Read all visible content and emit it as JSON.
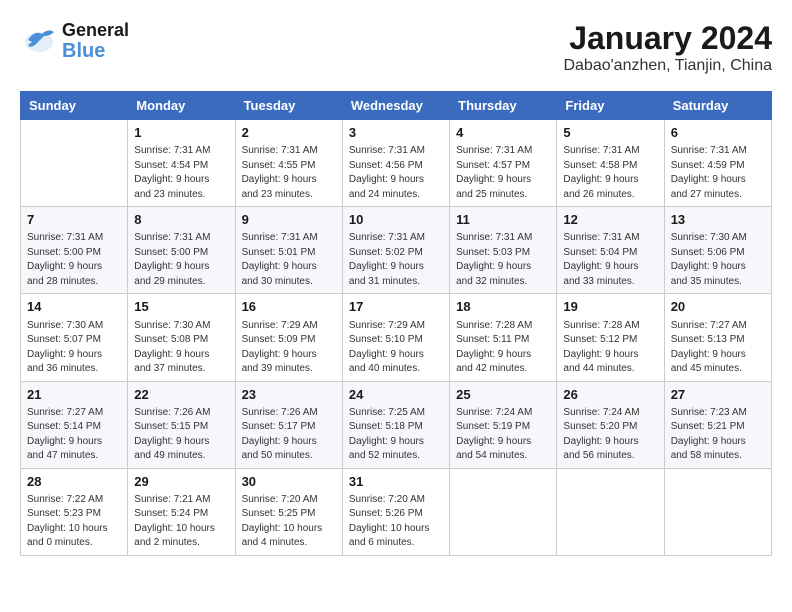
{
  "header": {
    "logo_general": "General",
    "logo_blue": "Blue",
    "month": "January 2024",
    "location": "Dabao'anzhen, Tianjin, China"
  },
  "weekdays": [
    "Sunday",
    "Monday",
    "Tuesday",
    "Wednesday",
    "Thursday",
    "Friday",
    "Saturday"
  ],
  "weeks": [
    [
      {
        "day": "",
        "info": ""
      },
      {
        "day": "1",
        "info": "Sunrise: 7:31 AM\nSunset: 4:54 PM\nDaylight: 9 hours\nand 23 minutes."
      },
      {
        "day": "2",
        "info": "Sunrise: 7:31 AM\nSunset: 4:55 PM\nDaylight: 9 hours\nand 23 minutes."
      },
      {
        "day": "3",
        "info": "Sunrise: 7:31 AM\nSunset: 4:56 PM\nDaylight: 9 hours\nand 24 minutes."
      },
      {
        "day": "4",
        "info": "Sunrise: 7:31 AM\nSunset: 4:57 PM\nDaylight: 9 hours\nand 25 minutes."
      },
      {
        "day": "5",
        "info": "Sunrise: 7:31 AM\nSunset: 4:58 PM\nDaylight: 9 hours\nand 26 minutes."
      },
      {
        "day": "6",
        "info": "Sunrise: 7:31 AM\nSunset: 4:59 PM\nDaylight: 9 hours\nand 27 minutes."
      }
    ],
    [
      {
        "day": "7",
        "info": "Sunrise: 7:31 AM\nSunset: 5:00 PM\nDaylight: 9 hours\nand 28 minutes."
      },
      {
        "day": "8",
        "info": "Sunrise: 7:31 AM\nSunset: 5:00 PM\nDaylight: 9 hours\nand 29 minutes."
      },
      {
        "day": "9",
        "info": "Sunrise: 7:31 AM\nSunset: 5:01 PM\nDaylight: 9 hours\nand 30 minutes."
      },
      {
        "day": "10",
        "info": "Sunrise: 7:31 AM\nSunset: 5:02 PM\nDaylight: 9 hours\nand 31 minutes."
      },
      {
        "day": "11",
        "info": "Sunrise: 7:31 AM\nSunset: 5:03 PM\nDaylight: 9 hours\nand 32 minutes."
      },
      {
        "day": "12",
        "info": "Sunrise: 7:31 AM\nSunset: 5:04 PM\nDaylight: 9 hours\nand 33 minutes."
      },
      {
        "day": "13",
        "info": "Sunrise: 7:30 AM\nSunset: 5:06 PM\nDaylight: 9 hours\nand 35 minutes."
      }
    ],
    [
      {
        "day": "14",
        "info": "Sunrise: 7:30 AM\nSunset: 5:07 PM\nDaylight: 9 hours\nand 36 minutes."
      },
      {
        "day": "15",
        "info": "Sunrise: 7:30 AM\nSunset: 5:08 PM\nDaylight: 9 hours\nand 37 minutes."
      },
      {
        "day": "16",
        "info": "Sunrise: 7:29 AM\nSunset: 5:09 PM\nDaylight: 9 hours\nand 39 minutes."
      },
      {
        "day": "17",
        "info": "Sunrise: 7:29 AM\nSunset: 5:10 PM\nDaylight: 9 hours\nand 40 minutes."
      },
      {
        "day": "18",
        "info": "Sunrise: 7:28 AM\nSunset: 5:11 PM\nDaylight: 9 hours\nand 42 minutes."
      },
      {
        "day": "19",
        "info": "Sunrise: 7:28 AM\nSunset: 5:12 PM\nDaylight: 9 hours\nand 44 minutes."
      },
      {
        "day": "20",
        "info": "Sunrise: 7:27 AM\nSunset: 5:13 PM\nDaylight: 9 hours\nand 45 minutes."
      }
    ],
    [
      {
        "day": "21",
        "info": "Sunrise: 7:27 AM\nSunset: 5:14 PM\nDaylight: 9 hours\nand 47 minutes."
      },
      {
        "day": "22",
        "info": "Sunrise: 7:26 AM\nSunset: 5:15 PM\nDaylight: 9 hours\nand 49 minutes."
      },
      {
        "day": "23",
        "info": "Sunrise: 7:26 AM\nSunset: 5:17 PM\nDaylight: 9 hours\nand 50 minutes."
      },
      {
        "day": "24",
        "info": "Sunrise: 7:25 AM\nSunset: 5:18 PM\nDaylight: 9 hours\nand 52 minutes."
      },
      {
        "day": "25",
        "info": "Sunrise: 7:24 AM\nSunset: 5:19 PM\nDaylight: 9 hours\nand 54 minutes."
      },
      {
        "day": "26",
        "info": "Sunrise: 7:24 AM\nSunset: 5:20 PM\nDaylight: 9 hours\nand 56 minutes."
      },
      {
        "day": "27",
        "info": "Sunrise: 7:23 AM\nSunset: 5:21 PM\nDaylight: 9 hours\nand 58 minutes."
      }
    ],
    [
      {
        "day": "28",
        "info": "Sunrise: 7:22 AM\nSunset: 5:23 PM\nDaylight: 10 hours\nand 0 minutes."
      },
      {
        "day": "29",
        "info": "Sunrise: 7:21 AM\nSunset: 5:24 PM\nDaylight: 10 hours\nand 2 minutes."
      },
      {
        "day": "30",
        "info": "Sunrise: 7:20 AM\nSunset: 5:25 PM\nDaylight: 10 hours\nand 4 minutes."
      },
      {
        "day": "31",
        "info": "Sunrise: 7:20 AM\nSunset: 5:26 PM\nDaylight: 10 hours\nand 6 minutes."
      },
      {
        "day": "",
        "info": ""
      },
      {
        "day": "",
        "info": ""
      },
      {
        "day": "",
        "info": ""
      }
    ]
  ]
}
